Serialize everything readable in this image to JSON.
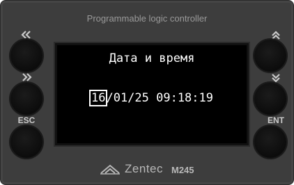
{
  "device": {
    "title": "Programmable logic controller",
    "brand": "Zentec",
    "model": "M245"
  },
  "display": {
    "heading": "Дата и время",
    "cursor_value": "16",
    "value_rest": "/01/25 09:18:19"
  },
  "buttons": {
    "left": [
      {
        "label": "«",
        "icon": "double-left-arrow-icon"
      },
      {
        "label": "»",
        "icon": "double-right-arrow-icon"
      },
      {
        "label": "ESC",
        "icon": ""
      }
    ],
    "right": [
      {
        "label": "⌃",
        "icon": "double-up-arrow-icon"
      },
      {
        "label": "⌄",
        "icon": "double-down-arrow-icon"
      },
      {
        "label": "ENT",
        "icon": ""
      }
    ]
  },
  "colors": {
    "panel": "#3d3d3d",
    "screen": "#000000",
    "screen_text": "#ffffff",
    "label": "#c9c9c9"
  }
}
